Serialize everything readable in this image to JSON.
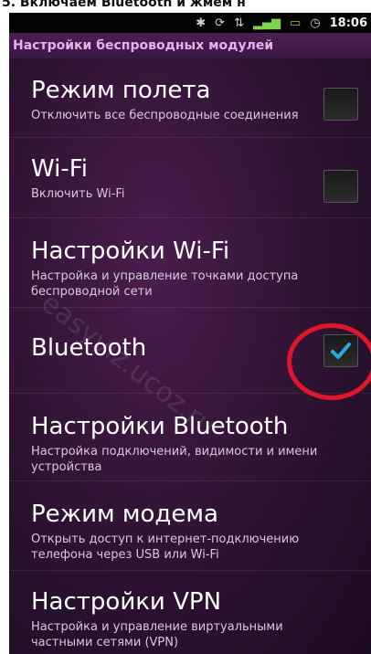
{
  "caption": "5. Включаем Bluetooth и жмем н",
  "status_bar": {
    "time": "18:06",
    "icons": [
      "bluetooth-icon",
      "sync-icon",
      "data-icon",
      "signal-icon",
      "battery-icon",
      "alarm-icon"
    ]
  },
  "screen": {
    "title": "Настройки беспроводных модулей"
  },
  "watermark": "easyviz.ucoz.ru",
  "items": [
    {
      "title": "Режим полета",
      "desc": "Отключить все беспроводные соединения",
      "checked": false
    },
    {
      "title": "Wi-Fi",
      "desc": "Включить Wi-Fi",
      "checked": false
    },
    {
      "title": "Настройки Wi-Fi",
      "desc": "Настройка и управление точками доступа беспроводной сети"
    },
    {
      "title": "Bluetooth",
      "desc": "",
      "checked": true
    },
    {
      "title": "Настройки Bluetooth",
      "desc": "Настройка подключений, видимости и имени устройства"
    },
    {
      "title": "Режим модема",
      "desc": "Открыть доступ к интернет-подключению телефона через USB или Wi-Fi"
    },
    {
      "title": "Настройки VPN",
      "desc": "Настройка и управление виртуальными частными сетями (VPN)"
    }
  ],
  "colors": {
    "accent": "#2aa9e0",
    "title_bar_text": "#e9b0ef",
    "highlight": "#e0162a"
  }
}
